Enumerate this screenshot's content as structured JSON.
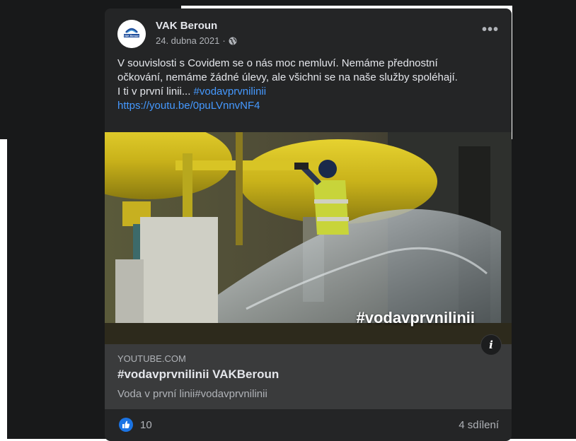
{
  "post": {
    "page_name": "VAK Beroun",
    "avatar_text": "VAK Beroun",
    "date": "24. dubna 2021",
    "date_separator": "·",
    "more_label": "•••",
    "text_line1": "V souvislosti s Covidem se o nás moc nemluví. Nemáme přednostní",
    "text_line2": "očkování, nemáme žádné úlevy, ale všichni se na naše služby spoléhají.",
    "text_line3": "I ti v první linii... ",
    "hashtag": "#vodavprvnilinii",
    "url": "https://youtu.be/0puLVnnvNF4"
  },
  "media": {
    "overlay_tag": "#vodavprvnilinii",
    "info_label": "i"
  },
  "link_preview": {
    "domain": "YOUTUBE.COM",
    "title": "#vodavprvnilinii VAKBeroun",
    "description": "Voda v první linii#vodavprvnilinii"
  },
  "footer": {
    "likes": "10",
    "shares": "4 sdílení"
  },
  "colors": {
    "background": "#18191a",
    "card": "#242526",
    "link": "#4599ff",
    "like_blue": "#1b74e4"
  },
  "icons": [
    "globe-icon",
    "more-icon",
    "info-icon",
    "like-icon"
  ]
}
